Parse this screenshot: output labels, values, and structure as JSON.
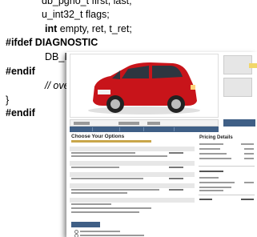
{
  "code": {
    "line1": "db_pgno_t first, last;",
    "line2": "u_int32_t flags;",
    "line3_kw": "int",
    "line3_rest": " empty, ret, t_ret;",
    "line4": "#ifdef DIAGNOSTIC",
    "line5": "DB_I",
    "line6": "#endif",
    "line7": "// ove",
    "line8": "}",
    "line9": "#endif"
  },
  "screenshot": {
    "section_title": "Choose Your Options",
    "pricing_title": "Pricing Details",
    "icons": [
      "car-photo",
      "thumbnail",
      "thumbnail"
    ]
  }
}
